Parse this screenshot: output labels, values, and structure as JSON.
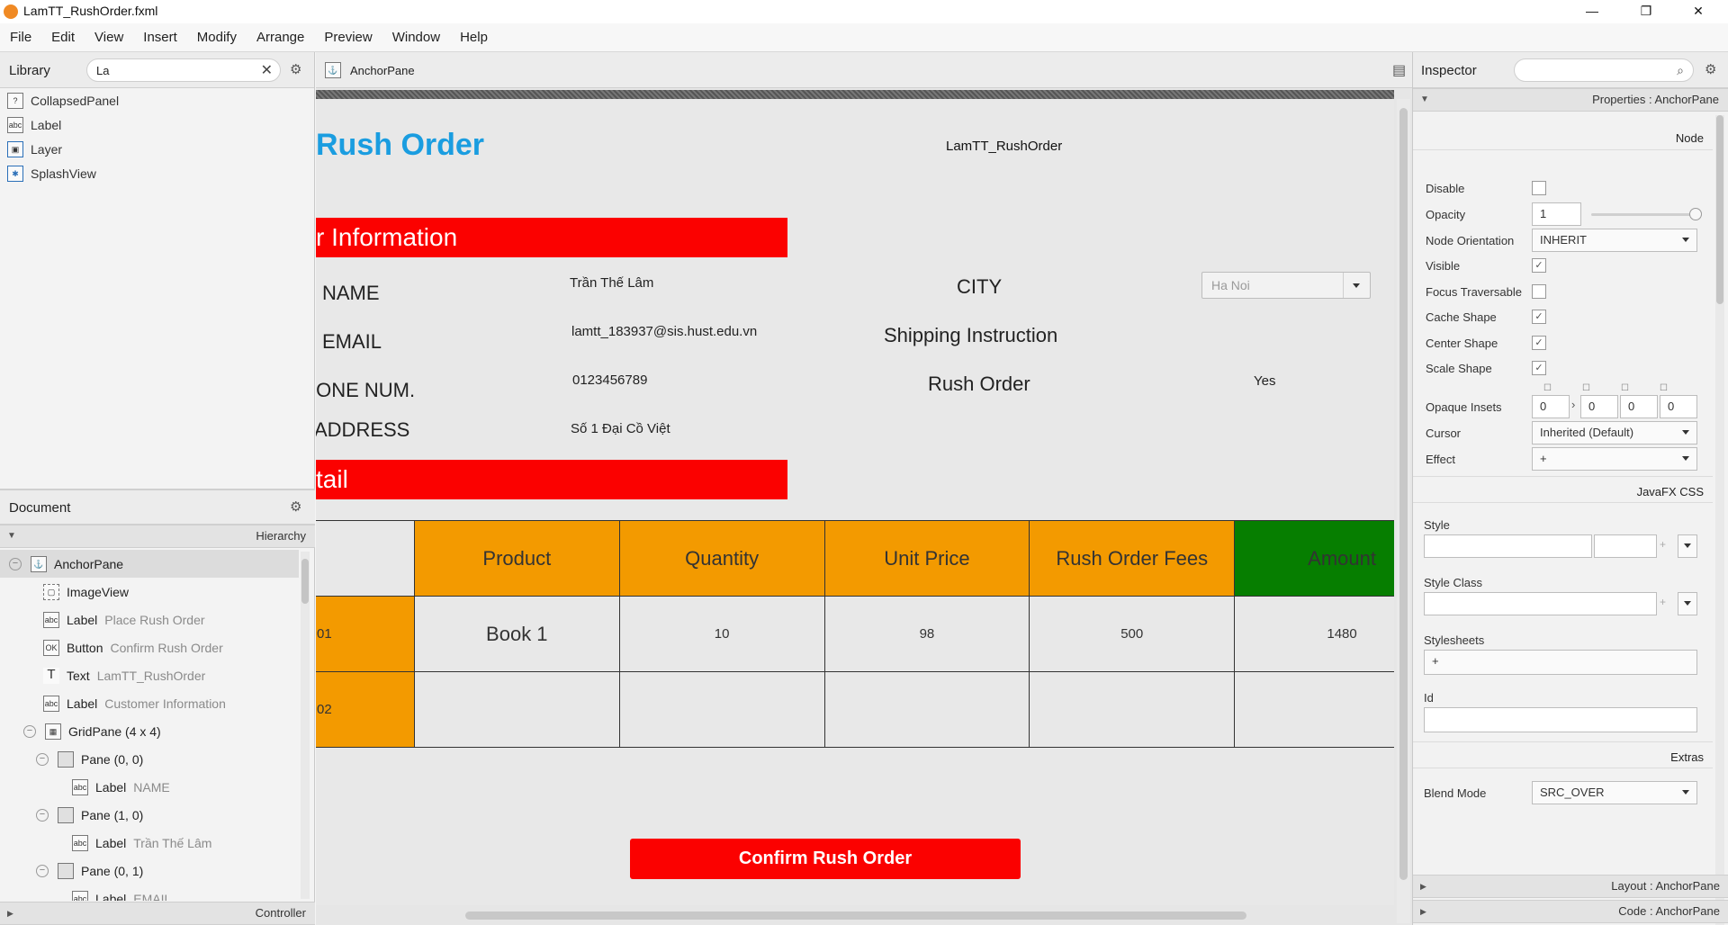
{
  "window": {
    "title": "LamTT_RushOrder.fxml",
    "minimize": "—",
    "restore": "❐",
    "close": "✕"
  },
  "menu": [
    "File",
    "Edit",
    "View",
    "Insert",
    "Modify",
    "Arrange",
    "Preview",
    "Window",
    "Help"
  ],
  "library": {
    "title": "Library",
    "search_value": "La",
    "items": [
      "CollapsedPanel",
      "Label",
      "Layer",
      "SplashView"
    ]
  },
  "document": {
    "title": "Document",
    "hierarchy_label": "Hierarchy",
    "controller_label": "Controller",
    "tree": [
      {
        "type": "AnchorPane",
        "name": ""
      },
      {
        "type": "ImageView",
        "name": ""
      },
      {
        "type": "Label",
        "name": "Place Rush Order"
      },
      {
        "type": "Button",
        "name": "Confirm Rush Order"
      },
      {
        "type": "Text",
        "name": "LamTT_RushOrder"
      },
      {
        "type": "Label",
        "name": "Customer Information"
      },
      {
        "type": "GridPane (4 x 4)",
        "name": ""
      },
      {
        "type": "Pane (0, 0)",
        "name": ""
      },
      {
        "type": "Label",
        "name": "NAME"
      },
      {
        "type": "Pane (1, 0)",
        "name": ""
      },
      {
        "type": "Label",
        "name": "Trần Thế Lâm"
      },
      {
        "type": "Pane (0, 1)",
        "name": ""
      },
      {
        "type": "Label",
        "name": "EMAIL"
      }
    ]
  },
  "editor": {
    "breadcrumb": "AnchorPane",
    "form": {
      "title": "Rush Order",
      "author": "LamTT_RushOrder",
      "customer_bar": "r Information",
      "detail_bar": "tail",
      "name_label": "NAME",
      "name_value": "Trần Thế Lâm",
      "email_label": "EMAIL",
      "email_value": "lamtt_183937@sis.hust.edu.vn",
      "phone_label": "IONE NUM.",
      "phone_value": "0123456789",
      "address_label": "ADDRESS",
      "address_value": "Số 1 Đại Cồ Việt",
      "city_label": "CITY",
      "city_placeholder": "Ha Noi",
      "shipping_label": "Shipping Instruction",
      "rush_label": "Rush Order",
      "rush_value": "Yes",
      "table": {
        "headers": [
          "",
          "Product",
          "Quantity",
          "Unit Price",
          "Rush Order Fees",
          "Amount"
        ],
        "rows": [
          [
            "01",
            "Book 1",
            "10",
            "98",
            "500",
            "1480"
          ],
          [
            "02",
            "",
            "",
            "",
            "",
            ""
          ]
        ]
      },
      "confirm_button": "Confirm Rush Order"
    }
  },
  "inspector": {
    "title": "Inspector",
    "properties_header": "Properties : AnchorPane",
    "node_label": "Node",
    "props": {
      "disable": "Disable",
      "opacity": "Opacity",
      "opacity_value": "1",
      "opacity_level": 1.0,
      "node_orientation": "Node Orientation",
      "node_orientation_value": "INHERIT",
      "visible": "Visible",
      "focus_traversable": "Focus Traversable",
      "cache_shape": "Cache Shape",
      "center_shape": "Center Shape",
      "scale_shape": "Scale Shape",
      "opaque_insets": "Opaque Insets",
      "opaque_insets_values": [
        "0",
        "0",
        "0",
        "0"
      ],
      "cursor": "Cursor",
      "cursor_value": "Inherited (Default)",
      "effect": "Effect",
      "effect_value": "+"
    },
    "css_label": "JavaFX CSS",
    "style": "Style",
    "style_class": "Style Class",
    "stylesheets": "Stylesheets",
    "stylesheets_add": "+",
    "id": "Id",
    "extras_label": "Extras",
    "blend_mode": "Blend Mode",
    "blend_mode_value": "SRC_OVER",
    "layout_header": "Layout : AnchorPane",
    "code_header": "Code : AnchorPane"
  },
  "colors": {
    "accent_blue": "#1a9de0",
    "red": "#fb0100",
    "orange": "#f39a00",
    "green": "#067e00"
  }
}
